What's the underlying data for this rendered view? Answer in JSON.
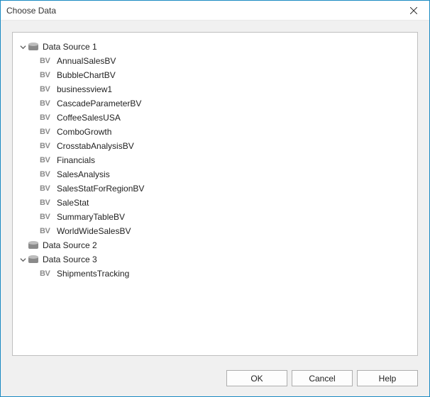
{
  "window": {
    "title": "Choose Data"
  },
  "tree": {
    "sources": [
      {
        "label": "Data Source 1",
        "expanded": true,
        "hasTwisty": true,
        "items": [
          {
            "label": "AnnualSalesBV"
          },
          {
            "label": "BubbleChartBV"
          },
          {
            "label": "businessview1"
          },
          {
            "label": "CascadeParameterBV"
          },
          {
            "label": "CoffeeSalesUSA"
          },
          {
            "label": "ComboGrowth"
          },
          {
            "label": "CrosstabAnalysisBV"
          },
          {
            "label": "Financials"
          },
          {
            "label": "SalesAnalysis"
          },
          {
            "label": "SalesStatForRegionBV"
          },
          {
            "label": "SaleStat"
          },
          {
            "label": "SummaryTableBV"
          },
          {
            "label": "WorldWideSalesBV"
          }
        ]
      },
      {
        "label": "Data Source 2",
        "expanded": false,
        "hasTwisty": false,
        "items": []
      },
      {
        "label": "Data Source 3",
        "expanded": true,
        "hasTwisty": true,
        "items": [
          {
            "label": "ShipmentsTracking"
          }
        ]
      }
    ]
  },
  "buttons": {
    "ok": "OK",
    "cancel": "Cancel",
    "help": "Help"
  },
  "icons": {
    "bv": "BV"
  }
}
